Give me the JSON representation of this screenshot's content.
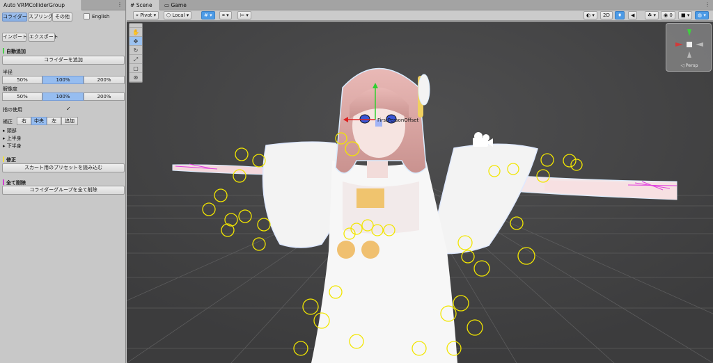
{
  "left_panel": {
    "tab_title": "Auto VRMColliderGroup",
    "tabs": [
      "コライダー",
      "スプリング",
      "その他"
    ],
    "english_label": "English",
    "import_label": "インポート",
    "export_label": "エクスポート",
    "auto_add": {
      "header": "自動追加",
      "button": "コライダーを追加"
    },
    "radius": {
      "label": "半径",
      "options": [
        "50%",
        "100%",
        "200%"
      ],
      "selected": "100%"
    },
    "resolution": {
      "label": "解像度",
      "options": [
        "50%",
        "100%",
        "200%"
      ],
      "selected": "100%"
    },
    "finger": {
      "label": "指の使用",
      "checked": true
    },
    "correction": {
      "label": "補正",
      "options": [
        "右",
        "中央",
        "左",
        "追加"
      ],
      "selected": "中央"
    },
    "body_parts": [
      "頭部",
      "上半身",
      "下半身"
    ],
    "fix": {
      "header": "修正",
      "button": "スカート用のプリセットを読み込む"
    },
    "delete": {
      "header": "全て削除",
      "button": "コライダーグループを全て削除"
    },
    "section_colors": {
      "auto_add": "#4ccf4c",
      "fix": "#f0e040",
      "delete": "#d040d0"
    }
  },
  "scene_panel": {
    "tabs": [
      "Scene",
      "Game"
    ],
    "active_tab": "Scene",
    "toolbar": {
      "pivot": "Pivot",
      "local": "Local",
      "mode_2d": "2D"
    },
    "gizmo_label": "Persp",
    "object_label": "FirstPersonOffset",
    "tools": [
      "hand-tool",
      "move-tool",
      "rotate-tool",
      "scale-tool",
      "rect-tool",
      "transform-tool"
    ],
    "selected_tool": "move-tool"
  }
}
